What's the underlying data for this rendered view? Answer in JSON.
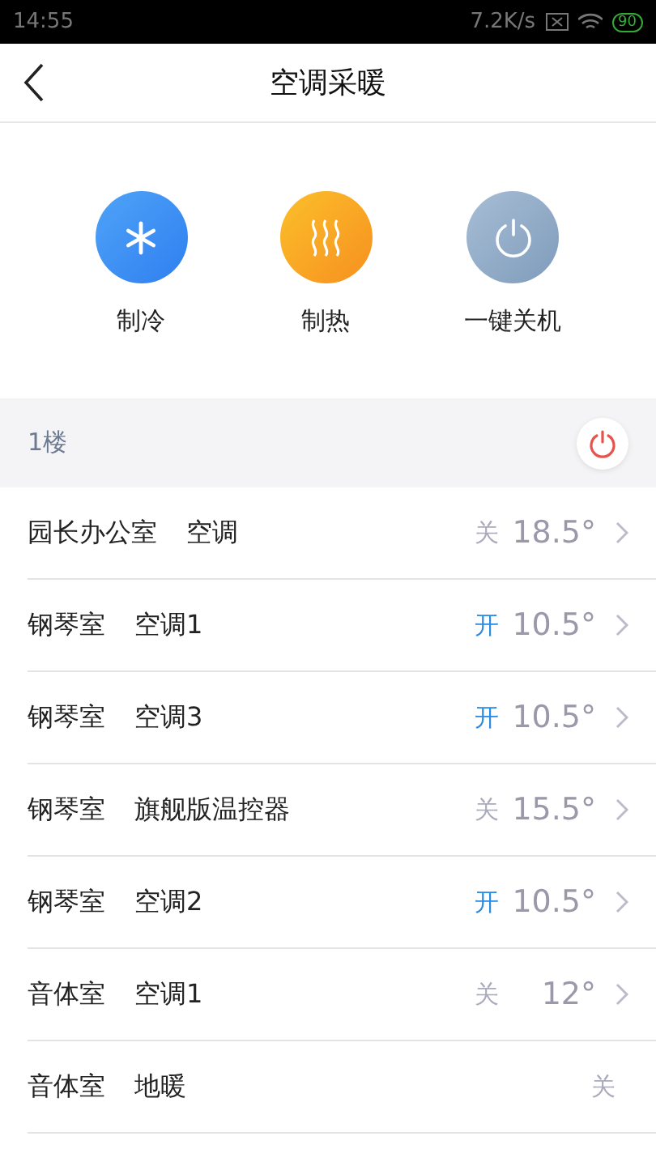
{
  "status_bar": {
    "time": "14:55",
    "speed": "7.2K/s",
    "battery": "90"
  },
  "header": {
    "title": "空调采暖"
  },
  "actions": [
    {
      "kind": "cool",
      "label": "制冷"
    },
    {
      "kind": "heat",
      "label": "制热"
    },
    {
      "kind": "power",
      "label": "一键关机"
    }
  ],
  "floor": {
    "name": "1楼"
  },
  "devices": [
    {
      "room": "园长办公室",
      "device": "空调",
      "on": false,
      "status": "关",
      "temp": "18.5°"
    },
    {
      "room": "钢琴室",
      "device": "空调1",
      "on": true,
      "status": "开",
      "temp": "10.5°"
    },
    {
      "room": "钢琴室",
      "device": "空调3",
      "on": true,
      "status": "开",
      "temp": "10.5°"
    },
    {
      "room": "钢琴室",
      "device": "旗舰版温控器",
      "on": false,
      "status": "关",
      "temp": "15.5°"
    },
    {
      "room": "钢琴室",
      "device": "空调2",
      "on": true,
      "status": "开",
      "temp": "10.5°"
    },
    {
      "room": "音体室",
      "device": "空调1",
      "on": false,
      "status": "关",
      "temp": "12°"
    },
    {
      "room": "音体室",
      "device": "地暖",
      "on": false,
      "status": "关"
    }
  ]
}
